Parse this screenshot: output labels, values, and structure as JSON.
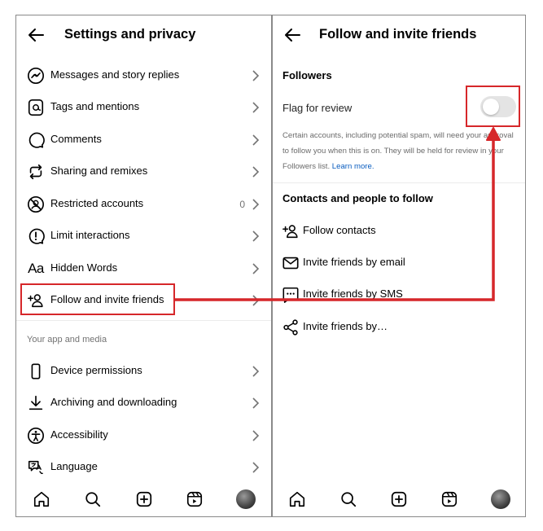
{
  "left": {
    "title": "Settings and privacy",
    "items": [
      {
        "label": "Messages and story replies",
        "icon": "messenger-icon"
      },
      {
        "label": "Tags and mentions",
        "icon": "at-sign-icon"
      },
      {
        "label": "Comments",
        "icon": "comment-icon"
      },
      {
        "label": "Sharing and remixes",
        "icon": "share-remix-icon"
      },
      {
        "label": "Restricted accounts",
        "icon": "restricted-icon",
        "count": "0"
      },
      {
        "label": "Limit interactions",
        "icon": "alert-circle-icon"
      },
      {
        "label": "Hidden Words",
        "icon": "hidden-words-icon",
        "glyph": "Aa"
      },
      {
        "label": "Follow and invite friends",
        "icon": "add-person-icon"
      }
    ],
    "section_label": "Your app and media",
    "items2": [
      {
        "label": "Device permissions",
        "icon": "device-icon"
      },
      {
        "label": "Archiving and downloading",
        "icon": "download-icon"
      },
      {
        "label": "Accessibility",
        "icon": "accessibility-icon"
      },
      {
        "label": "Language",
        "icon": "language-icon"
      }
    ]
  },
  "right": {
    "title": "Follow and invite friends",
    "followers_heading": "Followers",
    "flag_label": "Flag for review",
    "toggle_on": false,
    "desc_text": "Certain accounts, including potential spam, will need your approval to follow you when this is on. They will be held for review in your Followers list.",
    "learn_more": "Learn more.",
    "contacts_heading": "Contacts and people to follow",
    "items": [
      {
        "label": "Follow contacts",
        "icon": "add-person-icon"
      },
      {
        "label": "Invite friends by email",
        "icon": "mail-icon"
      },
      {
        "label": "Invite friends by SMS",
        "icon": "sms-icon"
      },
      {
        "label": "Invite friends by…",
        "icon": "share-icon"
      }
    ]
  },
  "nav": [
    "home-icon",
    "search-icon",
    "create-icon",
    "reels-icon",
    "profile-avatar"
  ],
  "colors": {
    "highlight": "#d6272a",
    "link": "#0a5dbf",
    "muted": "#737373",
    "toggle_off": "#e4e4e4"
  }
}
